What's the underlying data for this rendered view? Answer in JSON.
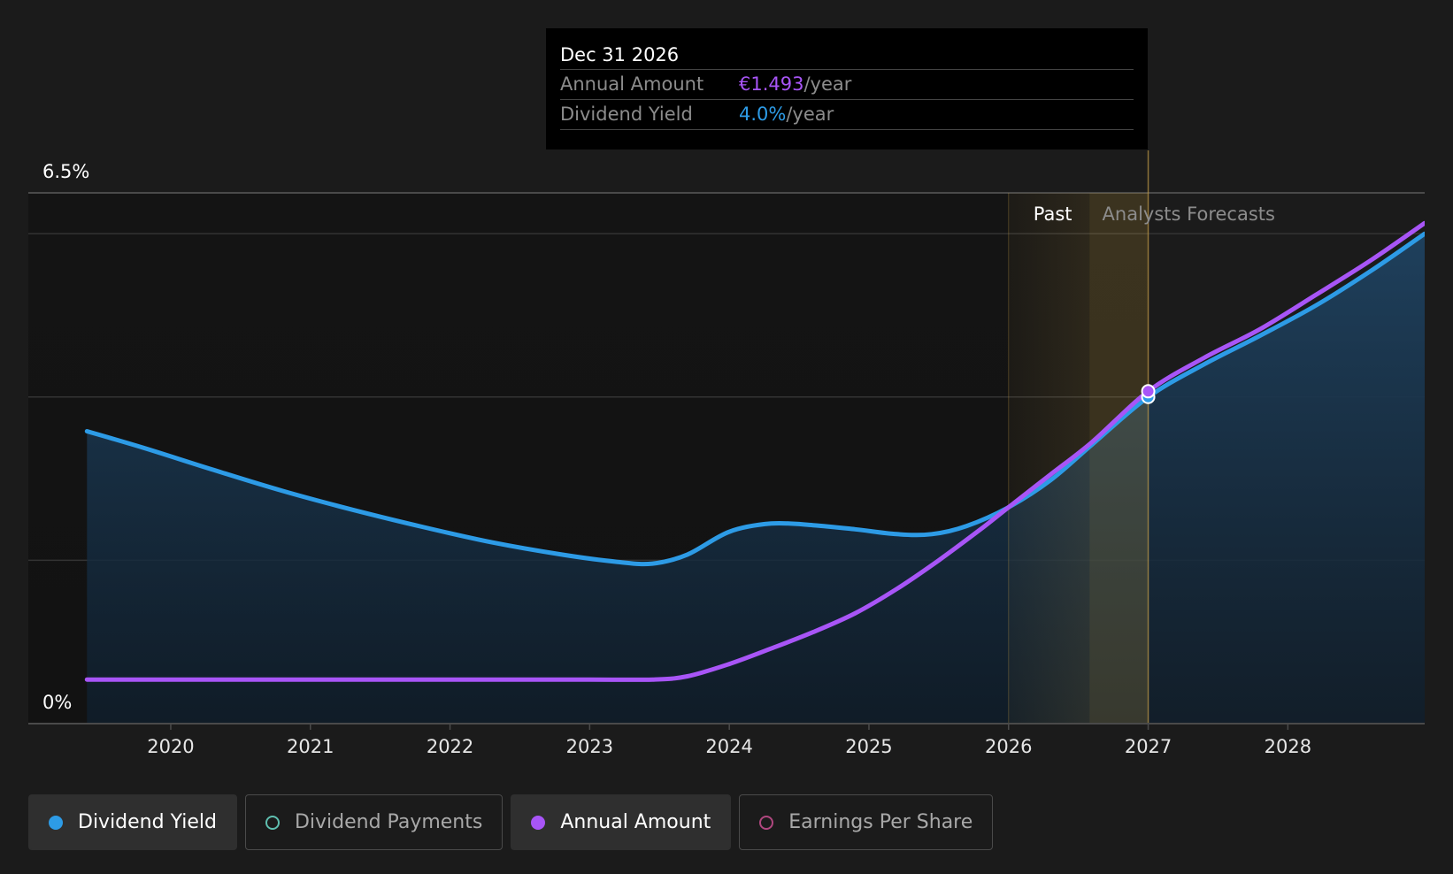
{
  "tooltip": {
    "date": "Dec 31 2026",
    "rows": [
      {
        "label": "Annual Amount",
        "value": "€1.493",
        "unit": "/year",
        "color": "#a855f7"
      },
      {
        "label": "Dividend Yield",
        "value": "4.0%",
        "unit": "/year",
        "color": "#2d9be6"
      }
    ]
  },
  "legend": [
    {
      "label": "Dividend Yield",
      "color": "#2d9be6",
      "filled": true,
      "active": true
    },
    {
      "label": "Dividend Payments",
      "color": "#5fbfb0",
      "filled": false,
      "active": false
    },
    {
      "label": "Annual Amount",
      "color": "#a855f7",
      "filled": true,
      "active": true
    },
    {
      "label": "Earnings Per Share",
      "color": "#b0477f",
      "filled": false,
      "active": false
    }
  ],
  "chart_data": {
    "type": "line",
    "y_top_label": "6.5%",
    "y_bottom_label": "0%",
    "ylim": [
      0,
      6.5
    ],
    "xlim": [
      2018.98,
      2028.98
    ],
    "x_ticks": [
      2020,
      2021,
      2022,
      2023,
      2024,
      2025,
      2026,
      2027,
      2028
    ],
    "x_tick_labels": [
      "2020",
      "2021",
      "2022",
      "2023",
      "2024",
      "2025",
      "2026",
      "2027",
      "2028"
    ],
    "past_label": "Past",
    "forecast_label": "Analysts Forecasts",
    "past_region": [
      2026.0,
      2026.58
    ],
    "highlight_region": [
      2026.58,
      2027.0
    ],
    "highlight_point": {
      "x": 2027.0,
      "yield": 4.0,
      "amount_on_yield_scale": 4.07
    },
    "colors": {
      "yield": "#2d9be6",
      "amount": "#a855f7",
      "highlight": "#c9a24a"
    },
    "series": [
      {
        "name": "Dividend Yield",
        "unit": "%",
        "x": [
          2019.4,
          2019.8,
          2020.3,
          2020.8,
          2021.3,
          2021.8,
          2022.3,
          2022.8,
          2023.2,
          2023.45,
          2023.7,
          2024.0,
          2024.3,
          2024.6,
          2024.9,
          2025.2,
          2025.45,
          2025.7,
          2026.0,
          2026.3,
          2026.6,
          2027.0,
          2027.4,
          2027.8,
          2028.2,
          2028.6,
          2028.98
        ],
        "values": [
          3.58,
          3.38,
          3.11,
          2.85,
          2.62,
          2.41,
          2.22,
          2.07,
          1.98,
          1.96,
          2.07,
          2.35,
          2.45,
          2.43,
          2.38,
          2.32,
          2.32,
          2.42,
          2.65,
          2.98,
          3.42,
          4.0,
          4.4,
          4.75,
          5.12,
          5.55,
          6.0
        ]
      },
      {
        "name": "Annual Amount",
        "unit": "€",
        "x": [
          2019.4,
          2020.0,
          2021.0,
          2022.0,
          2023.0,
          2023.45,
          2023.7,
          2024.0,
          2024.3,
          2024.6,
          2024.9,
          2025.2,
          2025.5,
          2025.8,
          2026.0,
          2026.3,
          2026.6,
          2027.0,
          2027.4,
          2027.8,
          2028.2,
          2028.6,
          2028.98
        ],
        "values": [
          0.54,
          0.54,
          0.54,
          0.54,
          0.54,
          0.54,
          0.58,
          0.73,
          0.92,
          1.12,
          1.35,
          1.65,
          2.0,
          2.38,
          2.65,
          3.05,
          3.45,
          4.07,
          4.48,
          4.83,
          5.25,
          5.68,
          6.13
        ]
      }
    ]
  }
}
